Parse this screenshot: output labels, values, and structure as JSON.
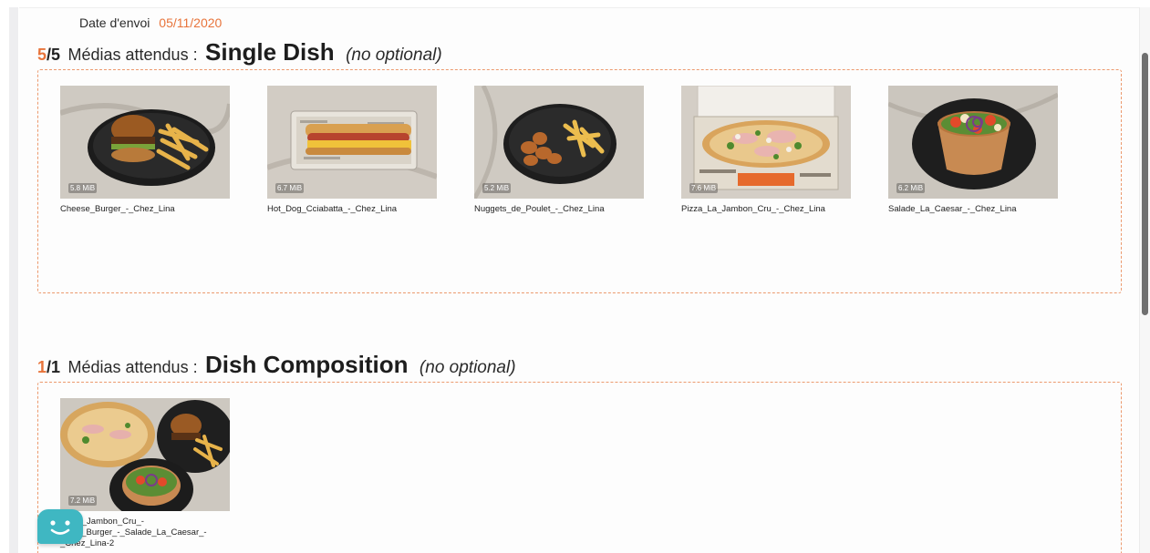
{
  "header": {
    "date_label": "Date d'envoi",
    "date_value": "05/11/2020"
  },
  "sections": [
    {
      "count_done": "5",
      "count_total": "/5",
      "expected_label": "Médias attendus :",
      "type_name": "Single Dish",
      "optional_note": "(no optional)",
      "items": [
        {
          "name": "Cheese_Burger_-_Chez_Lina",
          "size": "5.8 MiB",
          "icon": "burger-photo"
        },
        {
          "name": "Hot_Dog_Cciabatta_-_Chez_Lina",
          "size": "6.7 MiB",
          "icon": "hotdog-photo"
        },
        {
          "name": "Nuggets_de_Poulet_-_Chez_Lina",
          "size": "5.2 MiB",
          "icon": "nuggets-photo"
        },
        {
          "name": "Pizza_La_Jambon_Cru_-_Chez_Lina",
          "size": "7.6 MiB",
          "icon": "pizza-photo"
        },
        {
          "name": "Salade_La_Caesar_-_Chez_Lina",
          "size": "6.2 MiB",
          "icon": "salad-photo"
        }
      ]
    },
    {
      "count_done": "1",
      "count_total": "/1",
      "expected_label": "Médias attendus :",
      "type_name": "Dish Composition",
      "optional_note": "(no optional)",
      "items": [
        {
          "name": "..._La_Jambon_Cru_-\n...ese_Burger_-_Salade_La_Caesar_-\n_Chez_Lina-2",
          "size": "7.2 MiB",
          "icon": "composition-photo"
        }
      ]
    }
  ],
  "colors": {
    "accent": "#e8743b",
    "dashed_border": "#ec9a6e",
    "chat_widget": "#3fb7c2"
  },
  "chat": {
    "icon": "chat-smiley-icon"
  }
}
